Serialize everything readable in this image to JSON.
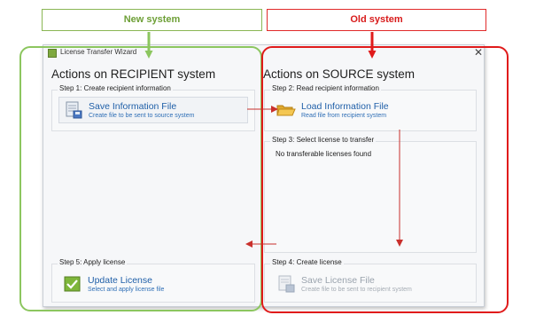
{
  "callouts": {
    "new_system": "New system",
    "old_system": "Old system"
  },
  "window": {
    "title": "License Transfer Wizard",
    "close_glyph": "✕"
  },
  "recipient": {
    "heading": "Actions on RECIPIENT system",
    "step1": {
      "legend": "Step 1: Create recipient information",
      "button_label": "Save Information File",
      "button_desc": "Create file to be sent to source system",
      "icon": "save-file-icon"
    },
    "step5": {
      "legend": "Step 5: Apply license",
      "button_label": "Update License",
      "button_desc": "Select and apply license file",
      "icon": "apply-check-icon"
    }
  },
  "source": {
    "heading": "Actions on SOURCE system",
    "step2": {
      "legend": "Step 2: Read recipient information",
      "button_label": "Load Information File",
      "button_desc": "Read file from recipient system",
      "icon": "folder-open-icon"
    },
    "step3": {
      "legend": "Step 3: Select license to transfer",
      "message": "No transferable licenses found"
    },
    "step4": {
      "legend": "Step 4: Create license",
      "button_label": "Save License File",
      "button_desc": "Create file to be sent to recipient system",
      "icon": "save-license-icon"
    }
  },
  "colors": {
    "new_system_accent": "#8cc65f",
    "old_system_accent": "#e01b1b",
    "link_blue": "#1f5fa8",
    "flow_arrow": "#c9302c"
  }
}
